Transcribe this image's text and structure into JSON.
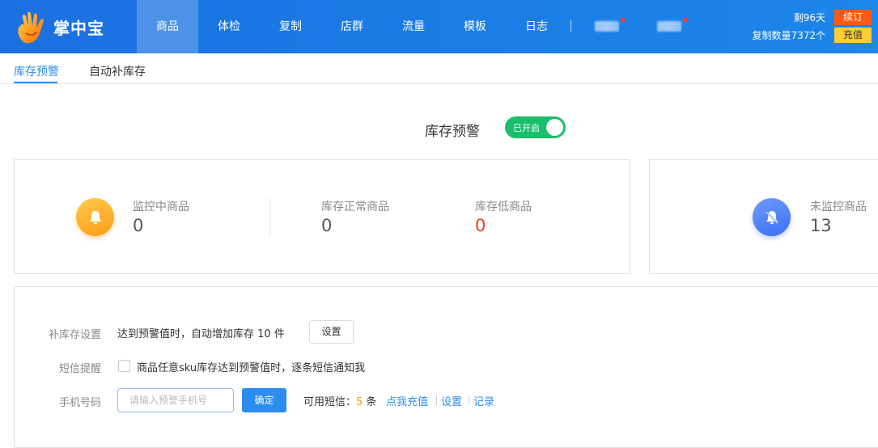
{
  "header": {
    "app_name": "掌中宝",
    "nav": [
      "商品",
      "体检",
      "复制",
      "店群",
      "流量",
      "模板",
      "日志"
    ],
    "active_nav": "商品",
    "account": {
      "remaining": "剩96天",
      "copy_count": "复制数量7372个",
      "renew_label": "续订",
      "recharge_label": "充值"
    }
  },
  "tabs": [
    "库存预警",
    "自动补库存"
  ],
  "warning": {
    "title": "库存预警",
    "switch_label": "已开启",
    "switch_on": true
  },
  "stats": {
    "monitoring": {
      "label": "监控中商品",
      "value": "0"
    },
    "normal": {
      "label": "库存正常商品",
      "value": "0"
    },
    "low": {
      "label": "库存低商品",
      "value": "0"
    },
    "unmonitored": {
      "label": "未监控商品",
      "value": "13"
    }
  },
  "settings": {
    "restock": {
      "label": "补库存设置",
      "text": "达到预警值时，自动增加库存 10 件",
      "button": "设置"
    },
    "sms": {
      "label": "短信提醒",
      "checkbox_text": "商品任意sku库存达到预警值时，逐条短信通知我",
      "checked": false
    },
    "phone": {
      "label": "手机号码",
      "placeholder": "请输入预警手机号",
      "value": "",
      "confirm": "确定",
      "available_prefix": "可用短信：",
      "available_count": "5",
      "available_suffix": " 条",
      "links": [
        "点我充值",
        "设置",
        "记录"
      ]
    }
  },
  "colors": {
    "topbar": "#1a7ee6",
    "accent": "#2d8cf0",
    "switch_on": "#19be6b",
    "renew": "#ff5a14",
    "recharge": "#ffcc33",
    "low_value": "#ed3f14",
    "sms_count": "#ff9900"
  }
}
